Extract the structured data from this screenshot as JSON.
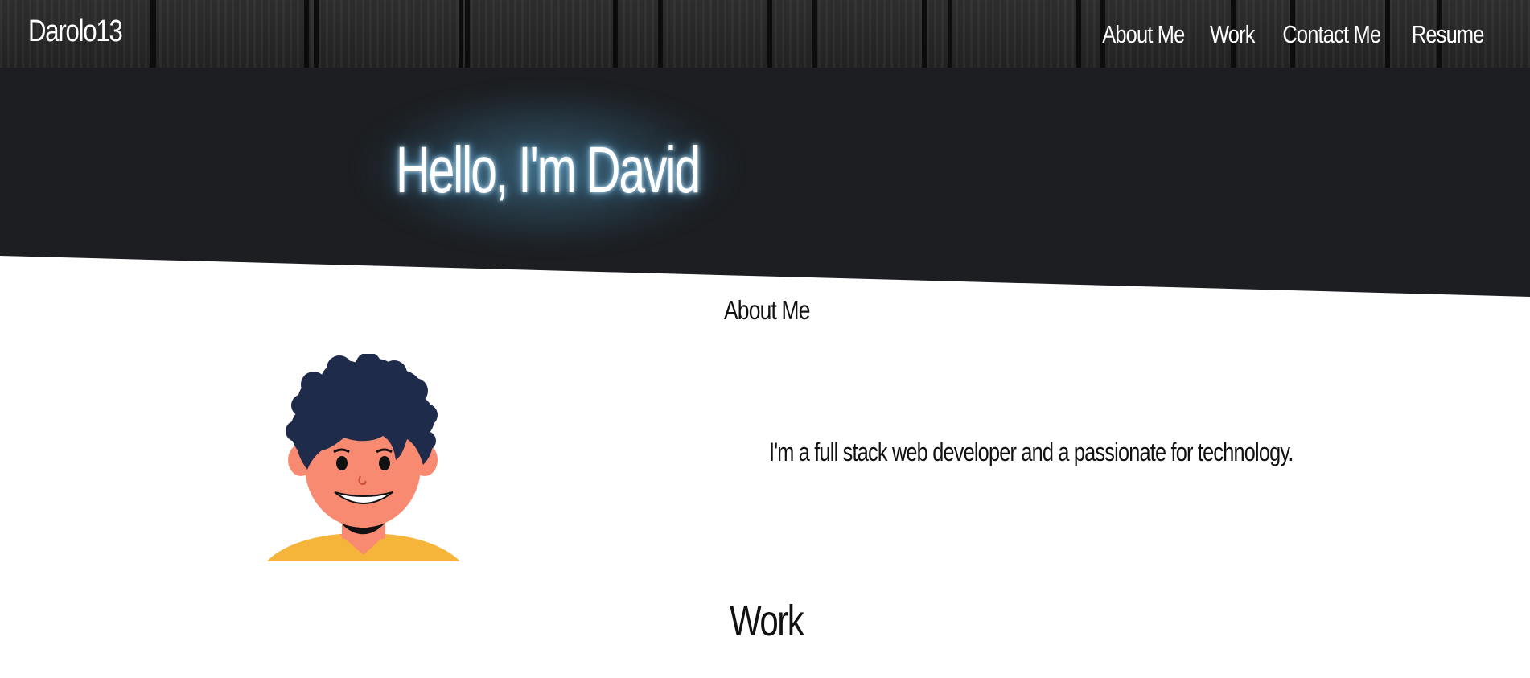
{
  "nav": {
    "brand": "Darolo13",
    "links": [
      {
        "label": "About Me"
      },
      {
        "label": "Work"
      },
      {
        "label": "Contact Me"
      },
      {
        "label": "Resume"
      }
    ]
  },
  "hero": {
    "title": "Hello, I'm David"
  },
  "about": {
    "heading": "About Me",
    "avatar_icon": "cartoon-boy-avatar",
    "text": "I'm a full stack web developer and a passionate for technology."
  },
  "work": {
    "heading": "Work"
  },
  "colors": {
    "hero_bg": "#1c1e21",
    "nav_bg": "#2a2a2a",
    "glow": "#5a9ec0",
    "hair": "#1f2b4a",
    "skin": "#f98a72",
    "shirt": "#f4b53a"
  }
}
